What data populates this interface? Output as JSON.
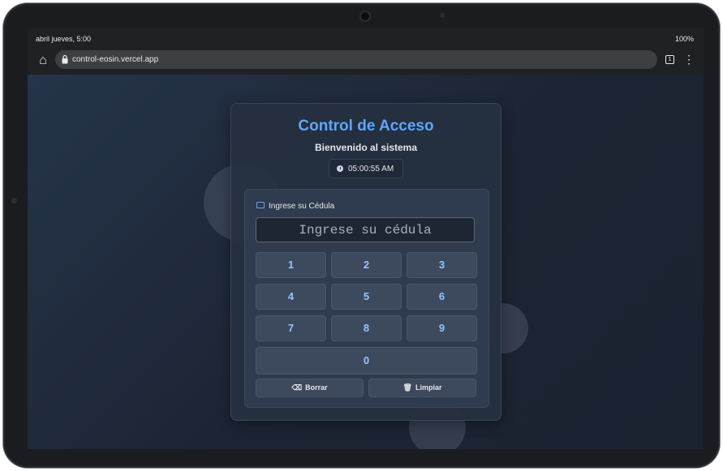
{
  "status_bar": {
    "time": "abril jueves, 5:00",
    "battery": "100%"
  },
  "browser": {
    "url": "control-eosin.vercel.app",
    "tab_count": "1"
  },
  "app": {
    "title": "Control de Acceso",
    "subtitle": "Bienvenido al sistema",
    "clock": "05:00:55 AM",
    "input_label": "Ingrese su Cédula",
    "input_placeholder": "Ingrese su cédula",
    "input_value": "",
    "keypad": [
      "1",
      "2",
      "3",
      "4",
      "5",
      "6",
      "7",
      "8",
      "9",
      "0"
    ],
    "borrar_label": "Borrar",
    "limpiar_label": "Limpiar"
  },
  "colors": {
    "accent": "#60a5fa",
    "key_text": "#93c5fd",
    "page_bg": "#1f2a3a"
  },
  "icons": [
    "home-icon",
    "lock-icon",
    "tabs-icon",
    "more-menu-icon",
    "clock-icon",
    "id-card-icon",
    "backspace-icon",
    "trash-icon"
  ]
}
